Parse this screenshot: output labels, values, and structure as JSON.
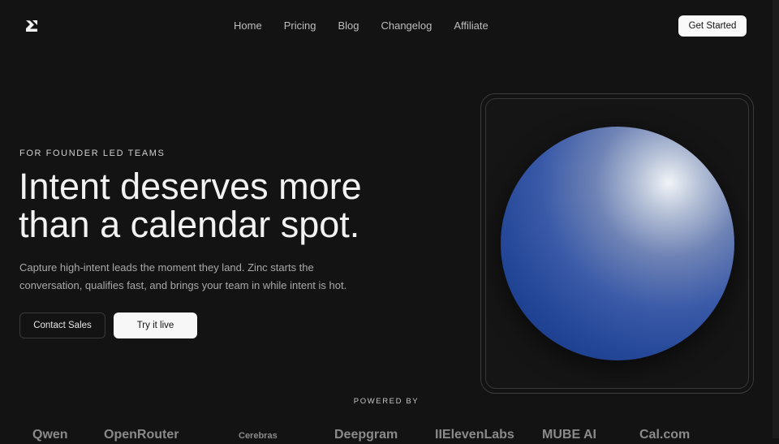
{
  "nav": {
    "logo_icon": "zinc-logo-icon",
    "links": [
      "Home",
      "Pricing",
      "Blog",
      "Changelog",
      "Affiliate"
    ],
    "cta": "Get Started"
  },
  "hero": {
    "eyebrow": "FOR FOUNDER LED TEAMS",
    "headline_line1": "Intent deserves more",
    "headline_line2": "than a calendar spot.",
    "subtitle": "Capture high-intent leads the moment they land. Zinc starts the conversation, qualifies fast, and brings your team in while intent is hot.",
    "primary_button": "Contact Sales",
    "secondary_button": "Try it live"
  },
  "powered_by": {
    "label": "POWERED BY",
    "logos": [
      "Qwen",
      "OpenRouter",
      "Cerebras",
      "Deepgram",
      "IIElevenLabs",
      "MUBE AI",
      "Cal.com"
    ]
  },
  "colors": {
    "background": "#131313",
    "sphere": "#244797",
    "button_light": "#f7f7f7"
  }
}
